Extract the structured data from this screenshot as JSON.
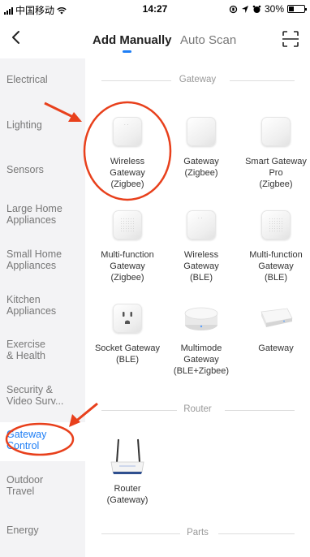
{
  "status_bar": {
    "carrier": "中国移动",
    "time": "14:27",
    "battery": "30%",
    "battery_level": 0.3
  },
  "nav": {
    "tab_add": "Add Manually",
    "tab_auto": "Auto Scan",
    "accent_color": "#1e7ef5"
  },
  "sidebar": {
    "items": [
      {
        "label": "Electrical"
      },
      {
        "label": "Lighting"
      },
      {
        "label": "Sensors"
      },
      {
        "label": "Large Home\nAppliances"
      },
      {
        "label": "Small Home\nAppliances"
      },
      {
        "label": "Kitchen\nAppliances"
      },
      {
        "label": "Exercise\n& Health"
      },
      {
        "label": "Security &\nVideo Surv..."
      },
      {
        "label": "Gateway\nControl",
        "active": true
      },
      {
        "label": "Outdoor\nTravel"
      },
      {
        "label": "Energy"
      }
    ]
  },
  "sections": {
    "gateway": "Gateway",
    "router": "Router",
    "parts": "Parts"
  },
  "devices": {
    "wireless_zigbee": "Wireless\nGateway\n(Zigbee)",
    "gateway_zigbee": "Gateway\n(Zigbee)",
    "smart_gateway_pro": "Smart Gateway\nPro\n(Zigbee)",
    "multifunction_zigbee": "Multi-function\nGateway\n(Zigbee)",
    "wireless_ble": "Wireless\nGateway\n(BLE)",
    "multifunction_ble": "Multi-function\nGateway\n(BLE)",
    "socket_ble": "Socket Gateway\n(BLE)",
    "multimode": "Multimode\nGateway\n(BLE+Zigbee)",
    "gateway": "Gateway",
    "router": "Router\n(Gateway)"
  },
  "annotation_color": "#e8401c"
}
